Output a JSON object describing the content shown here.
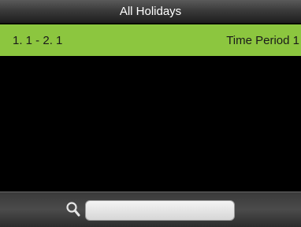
{
  "header": {
    "title": "All Holidays"
  },
  "list": {
    "items": [
      {
        "date_range": "1. 1 -  2. 1",
        "time_period": "Time Period 1",
        "selected": true
      }
    ]
  },
  "search": {
    "value": "",
    "placeholder": "",
    "icon": "search-icon"
  },
  "colors": {
    "selected_row": "#8cc63f",
    "background": "#000000",
    "title_text": "#ffffff"
  }
}
